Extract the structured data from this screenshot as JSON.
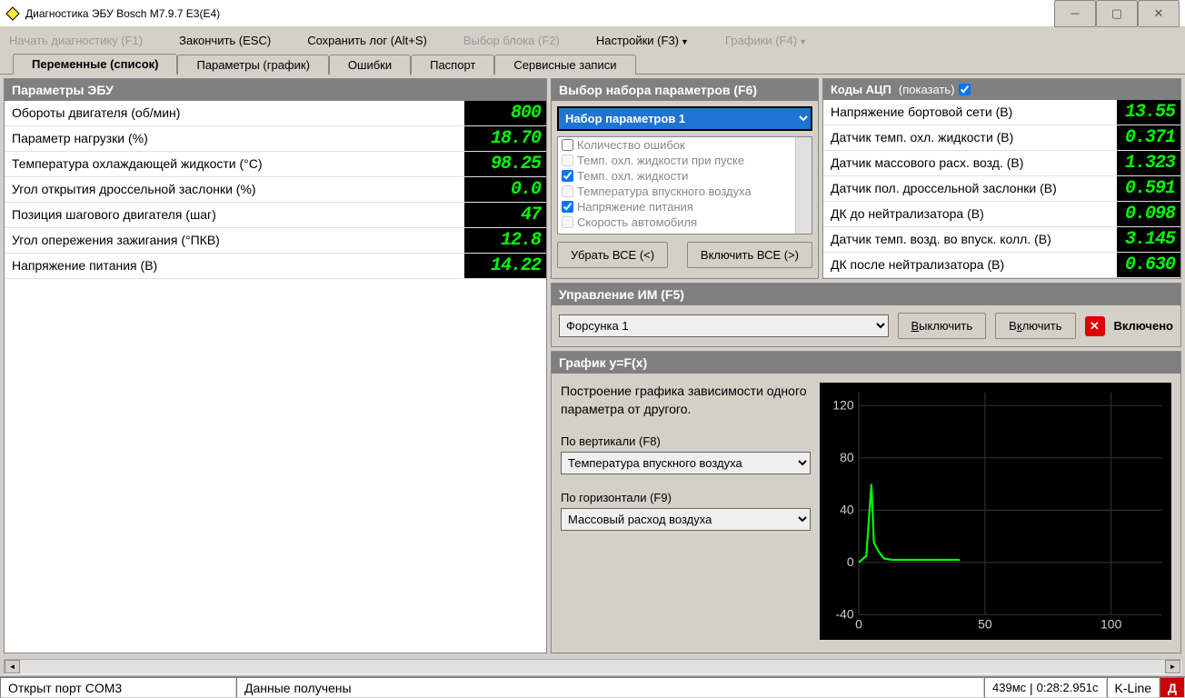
{
  "window": {
    "title": "Диагностика ЭБУ Bosch M7.9.7 E3(E4)"
  },
  "toolbar": {
    "start": "Начать диагностику (F1)",
    "finish": "Закончить (ESC)",
    "save_log": "Сохранить лог (Alt+S)",
    "block_sel": "Выбор блока (F2)",
    "settings": "Настройки (F3)",
    "charts": "Графики (F4)"
  },
  "tabs": [
    "Переменные (список)",
    "Параметры (график)",
    "Ошибки",
    "Паспорт",
    "Сервисные записи"
  ],
  "ecu_params": {
    "title": "Параметры ЭБУ",
    "rows": [
      {
        "label": "Обороты двигателя (об/мин)",
        "value": "800"
      },
      {
        "label": "Параметр нагрузки (%)",
        "value": "18.70"
      },
      {
        "label": "Температура охлаждающей жидкости (°C)",
        "value": "98.25"
      },
      {
        "label": "Угол открытия дроссельной заслонки (%)",
        "value": "0.0"
      },
      {
        "label": "Позиция шагового двигателя (шаг)",
        "value": "47"
      },
      {
        "label": "Угол опережения зажигания (°ПКВ)",
        "value": "12.8"
      },
      {
        "label": "Напряжение питания (В)",
        "value": "14.22"
      }
    ]
  },
  "param_set": {
    "title": "Выбор набора параметров (F6)",
    "selected": "Набор параметров 1",
    "items": [
      {
        "label": "Количество ошибок",
        "checked": false
      },
      {
        "label": "Темп. охл. жидкости при пуске",
        "checked": false,
        "disabled": true
      },
      {
        "label": "Темп. охл. жидкости",
        "checked": true
      },
      {
        "label": "Температура впускного воздуха",
        "checked": false,
        "disabled": true
      },
      {
        "label": "Напряжение питания",
        "checked": true
      },
      {
        "label": "Скорость автомобиля",
        "checked": false,
        "disabled": true
      }
    ],
    "btn_remove": "Убрать ВСЕ (<)",
    "btn_add": "Включить ВСЕ (>)"
  },
  "adc": {
    "title": "Коды АЦП",
    "show_label": "(показать)",
    "rows": [
      {
        "label": "Напряжение бортовой сети (В)",
        "value": "13.55"
      },
      {
        "label": "Датчик темп. охл. жидкости (В)",
        "value": "0.371"
      },
      {
        "label": "Датчик массового расх. возд. (В)",
        "value": "1.323"
      },
      {
        "label": "Датчик пол. дроссельной заслонки (В)",
        "value": "0.591"
      },
      {
        "label": "ДК до нейтрализатора (В)",
        "value": "0.098"
      },
      {
        "label": "Датчик темп. возд. во впуск. колл. (В)",
        "value": "3.145"
      },
      {
        "label": "ДК после нейтрализатора (В)",
        "value": "0.630"
      }
    ]
  },
  "im": {
    "title": "Управление ИМ (F5)",
    "selected": "Форсунка 1",
    "btn_off": "Выключить",
    "btn_on": "Включить",
    "status": "Включено"
  },
  "graph": {
    "title": "График y=F(x)",
    "desc": "Построение графика зависимости одного параметра от другого.",
    "y_label": "По вертикали (F8)",
    "y_sel": "Температура впускного воздуха",
    "x_label": "По горизонтали (F9)",
    "x_sel": "Массовый расход воздуха"
  },
  "status": {
    "port": "Открыт порт COM3",
    "data": "Данные получены",
    "ms": "439мс",
    "time": "0:28:2.951с",
    "kline": "K-Line",
    "d": "Д"
  },
  "chart_data": {
    "type": "line",
    "title": "График y=F(x)",
    "xlabel": "Массовый расход воздуха",
    "ylabel": "Температура впускного воздуха",
    "xlim": [
      0,
      120
    ],
    "ylim": [
      -40,
      130
    ],
    "y_ticks": [
      -40,
      0,
      40,
      80,
      120
    ],
    "x_ticks": [
      0,
      50,
      100
    ],
    "series": [
      {
        "name": "trace",
        "x": [
          0,
          3,
          5,
          6,
          8,
          10,
          13,
          16,
          20,
          25,
          30,
          35,
          40
        ],
        "values": [
          0,
          5,
          60,
          15,
          8,
          3,
          2,
          2,
          2,
          2,
          2,
          2,
          2
        ]
      }
    ]
  }
}
